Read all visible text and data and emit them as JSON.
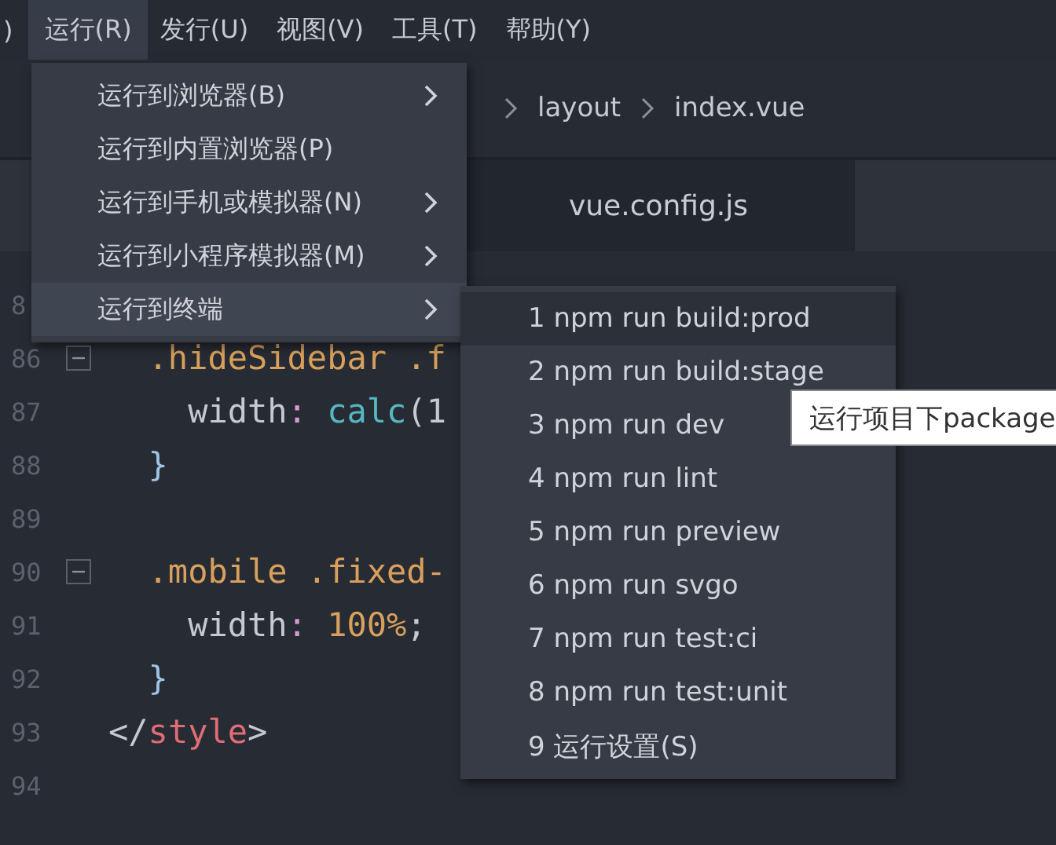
{
  "menubar": [
    {
      "label": ")",
      "selected": false
    },
    {
      "label": "运行(R)",
      "selected": true
    },
    {
      "label": "发行(U)",
      "selected": false
    },
    {
      "label": "视图(V)",
      "selected": false
    },
    {
      "label": "工具(T)",
      "selected": false
    },
    {
      "label": "帮助(Y)",
      "selected": false
    }
  ],
  "breadcrumb": [
    "layout",
    "index.vue"
  ],
  "tabs": [
    {
      "label": "vue.config.js"
    }
  ],
  "editor": {
    "lines": [
      {
        "number": "8",
        "fold": false
      },
      {
        "number": "86",
        "fold": true,
        "tokens": [
          {
            "kind": "selector",
            "text": "  .hideSidebar .f"
          }
        ]
      },
      {
        "number": "87",
        "fold": false,
        "tokens": [
          {
            "kind": "plain",
            "text": "    width"
          },
          {
            "kind": "punct",
            "text": ": "
          },
          {
            "kind": "func",
            "text": "calc"
          },
          {
            "kind": "plain",
            "text": "(1"
          }
        ]
      },
      {
        "number": "88",
        "fold": false,
        "tokens": [
          {
            "kind": "brace",
            "text": "  }"
          }
        ]
      },
      {
        "number": "89",
        "fold": false
      },
      {
        "number": "90",
        "fold": true,
        "tokens": [
          {
            "kind": "selector",
            "text": "  .mobile .fixed-"
          }
        ]
      },
      {
        "number": "91",
        "fold": false,
        "tokens": [
          {
            "kind": "plain",
            "text": "    width"
          },
          {
            "kind": "punct",
            "text": ": "
          },
          {
            "kind": "number",
            "text": "100%"
          },
          {
            "kind": "plain",
            "text": ";"
          }
        ]
      },
      {
        "number": "92",
        "fold": false,
        "tokens": [
          {
            "kind": "brace",
            "text": "  }"
          }
        ]
      },
      {
        "number": "93",
        "fold": false,
        "tokens": [
          {
            "kind": "plain",
            "text": "</"
          },
          {
            "kind": "tag",
            "text": "style"
          },
          {
            "kind": "plain",
            "text": ">"
          }
        ]
      },
      {
        "number": "94",
        "fold": false
      }
    ]
  },
  "run_menu": [
    {
      "label": "运行到浏览器(B)",
      "has_submenu": true,
      "selected": false
    },
    {
      "label": "运行到内置浏览器(P)",
      "has_submenu": false,
      "selected": false
    },
    {
      "label": "运行到手机或模拟器(N)",
      "has_submenu": true,
      "selected": false
    },
    {
      "label": "运行到小程序模拟器(M)",
      "has_submenu": true,
      "selected": false
    },
    {
      "label": "运行到终端",
      "has_submenu": true,
      "selected": true
    }
  ],
  "terminal_menu": [
    {
      "label": "1 npm run build:prod",
      "selected": true
    },
    {
      "label": "2 npm run build:stage",
      "selected": false
    },
    {
      "label": "3 npm run dev",
      "selected": false
    },
    {
      "label": "4 npm run lint",
      "selected": false
    },
    {
      "label": "5 npm run preview",
      "selected": false
    },
    {
      "label": "6 npm run svgo",
      "selected": false
    },
    {
      "label": "7 npm run test:ci",
      "selected": false
    },
    {
      "label": "8 npm run test:unit",
      "selected": false
    },
    {
      "label": "9 运行设置(S)",
      "selected": false
    }
  ],
  "tooltip": "运行项目下package"
}
